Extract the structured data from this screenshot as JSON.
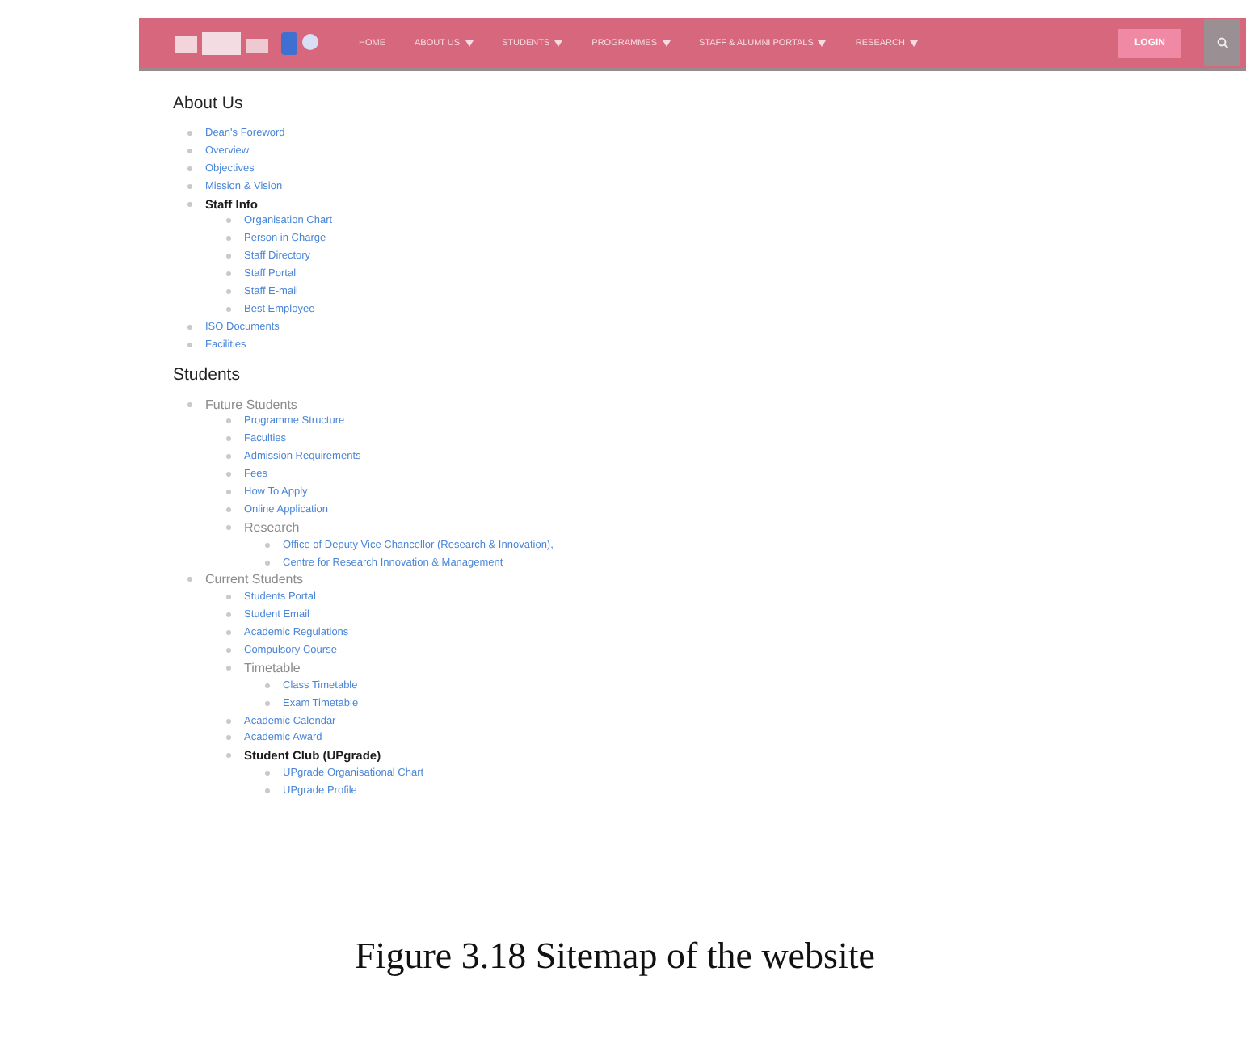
{
  "navbar": {
    "menu": [
      {
        "label": "HOME",
        "dropdown": false
      },
      {
        "label": "ABOUT US",
        "dropdown": true
      },
      {
        "label": "STUDENTS",
        "dropdown": true
      },
      {
        "label": "PROGRAMMES",
        "dropdown": true
      },
      {
        "label": "STAFF & ALUMNI PORTALS",
        "dropdown": true
      },
      {
        "label": "RESEARCH",
        "dropdown": true
      }
    ],
    "button": "LOGIN"
  },
  "sections": [
    {
      "title": "About Us",
      "items": [
        {
          "label": "Dean's Foreword",
          "kind": "link"
        },
        {
          "label": "Overview",
          "kind": "link"
        },
        {
          "label": "Objectives",
          "kind": "link"
        },
        {
          "label": "Mission & Vision",
          "kind": "link"
        },
        {
          "label": "Staff Info",
          "kind": "active",
          "children": [
            {
              "label": "Organisation Chart",
              "kind": "link"
            },
            {
              "label": "Person in Charge",
              "kind": "link"
            },
            {
              "label": "Staff Directory",
              "kind": "link"
            },
            {
              "label": "Staff Portal",
              "kind": "link"
            },
            {
              "label": "Staff E-mail",
              "kind": "link"
            },
            {
              "label": "Best Employee",
              "kind": "link"
            }
          ]
        },
        {
          "label": "ISO Documents",
          "kind": "link"
        },
        {
          "label": "Facilities",
          "kind": "link"
        }
      ]
    },
    {
      "title": "Students",
      "items": [
        {
          "label": "Future Students",
          "kind": "heading",
          "children": [
            {
              "label": "Programme Structure",
              "kind": "link"
            },
            {
              "label": "Faculties",
              "kind": "link"
            },
            {
              "label": "Admission Requirements",
              "kind": "link"
            },
            {
              "label": "Fees",
              "kind": "link"
            },
            {
              "label": "How To Apply",
              "kind": "link"
            },
            {
              "label": "Online Application",
              "kind": "link"
            },
            {
              "label": "Research",
              "kind": "heading",
              "children": [
                {
                  "label": "Office of Deputy Vice Chancellor (Research & Innovation),",
                  "kind": "link"
                },
                {
                  "label": "Centre for Research Innovation & Management",
                  "kind": "link"
                }
              ]
            }
          ]
        },
        {
          "label": "Current Students",
          "kind": "heading",
          "children": [
            {
              "label": "Students Portal",
              "kind": "link"
            },
            {
              "label": "Student Email",
              "kind": "link"
            },
            {
              "label": "Academic Regulations",
              "kind": "link"
            },
            {
              "label": "Compulsory Course",
              "kind": "link"
            },
            {
              "label": "Timetable",
              "kind": "heading",
              "children": [
                {
                  "label": "Class Timetable",
                  "kind": "link"
                },
                {
                  "label": "Exam Timetable",
                  "kind": "link"
                }
              ]
            },
            {
              "label": "Academic Calendar",
              "kind": "link"
            },
            {
              "label": "Academic Award",
              "kind": "link"
            },
            {
              "label": "Student Club (UPgrade)",
              "kind": "active",
              "children": [
                {
                  "label": "UPgrade Organisational Chart",
                  "kind": "link"
                },
                {
                  "label": "UPgrade Profile",
                  "kind": "link"
                }
              ]
            }
          ]
        }
      ]
    }
  ],
  "caption": "Figure 3.18 Sitemap of the website"
}
